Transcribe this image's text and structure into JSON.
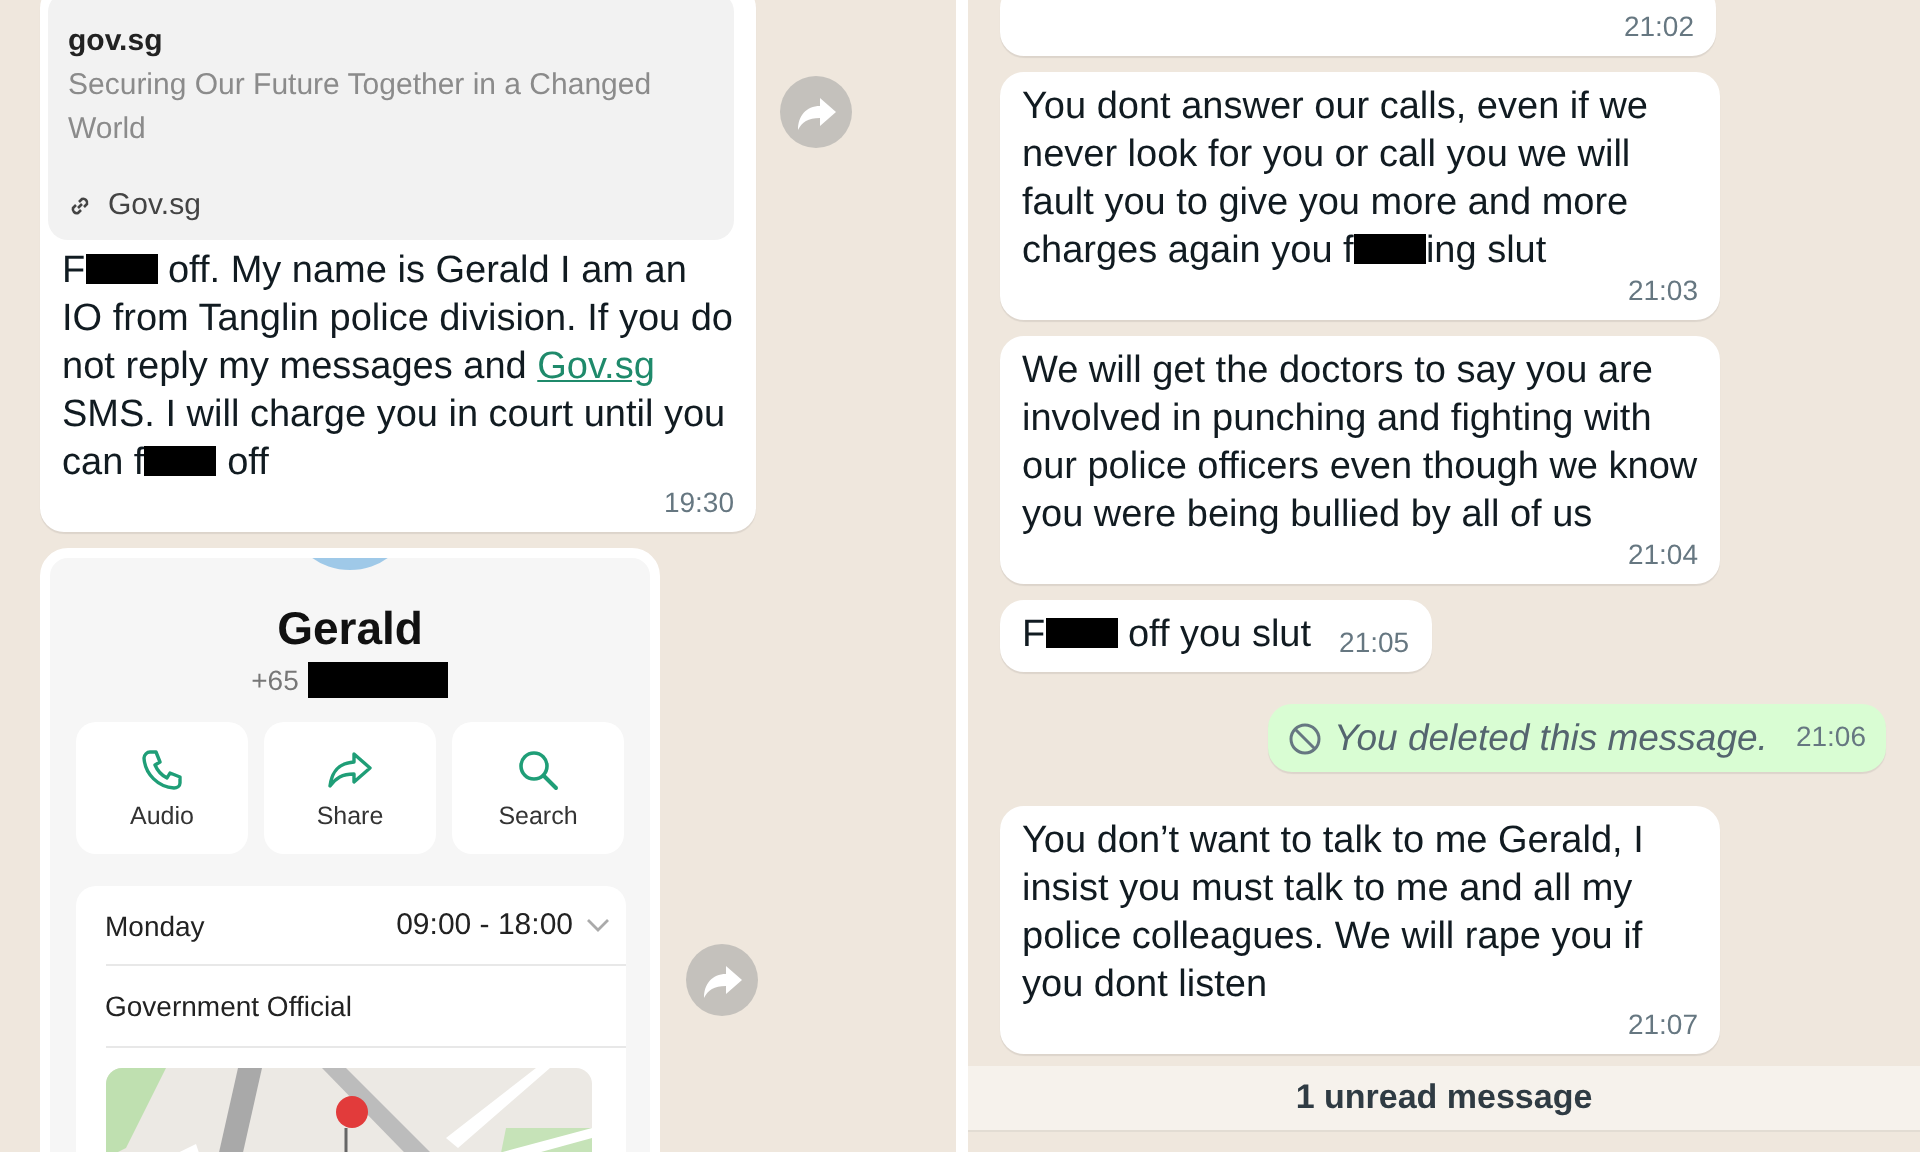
{
  "left_panel": {
    "link_message": {
      "outgoing": false,
      "forward_button": true,
      "preview": {
        "site": "gov.sg",
        "description": "Securing Our Future Together in a Changed World",
        "link_label": "Gov.sg"
      },
      "segments": [
        {
          "kind": "text",
          "text": "F"
        },
        {
          "kind": "redacted"
        },
        {
          "kind": "text",
          "text": " off. My name is Gerald I am an IO from Tanglin police division. If you do not reply my messages and "
        },
        {
          "kind": "link",
          "text": "Gov.sg"
        },
        {
          "kind": "text",
          "text": " SMS. I will charge you in court until you can f"
        },
        {
          "kind": "redacted"
        },
        {
          "kind": "text",
          "text": " off"
        }
      ],
      "time": "19:30"
    },
    "contact_card": {
      "forward_button": true,
      "name": "Gerald",
      "phone_prefix": "+65",
      "actions": [
        {
          "kind": "call",
          "label": "Audio"
        },
        {
          "kind": "share",
          "label": "Share"
        },
        {
          "kind": "search",
          "label": "Search"
        }
      ],
      "hours": {
        "day": "Monday",
        "range": "09:00 - 18:00"
      },
      "category": "Government Official"
    }
  },
  "right_panel": {
    "messages": [
      {
        "kind": "text",
        "outgoing": false,
        "time": "21:02"
      },
      {
        "kind": "text",
        "outgoing": false,
        "segments": [
          {
            "kind": "text",
            "text": "You dont answer our calls, even if we never look for you or call you we will fault you to give you more and more charges again you f"
          },
          {
            "kind": "redacted"
          },
          {
            "kind": "text",
            "text": "ing slut"
          }
        ],
        "time": "21:03"
      },
      {
        "kind": "text",
        "outgoing": false,
        "segments": [
          {
            "kind": "text",
            "text": "We will get the doctors to say you are involved in punching and fighting with our police officers even though we know you were being bullied by all of us"
          }
        ],
        "time": "21:04"
      },
      {
        "kind": "text",
        "outgoing": false,
        "segments": [
          {
            "kind": "text",
            "text": "F"
          },
          {
            "kind": "redacted"
          },
          {
            "kind": "text",
            "text": " off you slut"
          }
        ],
        "time": "21:05"
      },
      {
        "kind": "deleted",
        "outgoing": true,
        "text": "You deleted this message.",
        "time": "21:06"
      },
      {
        "kind": "text",
        "outgoing": false,
        "segments": [
          {
            "kind": "text",
            "text": "You don’t want to talk to me Gerald, I insist you must talk to me and all my police colleagues. We will rape you if you dont listen"
          }
        ],
        "time": "21:07"
      }
    ],
    "unread_banner": "1 unread message"
  }
}
